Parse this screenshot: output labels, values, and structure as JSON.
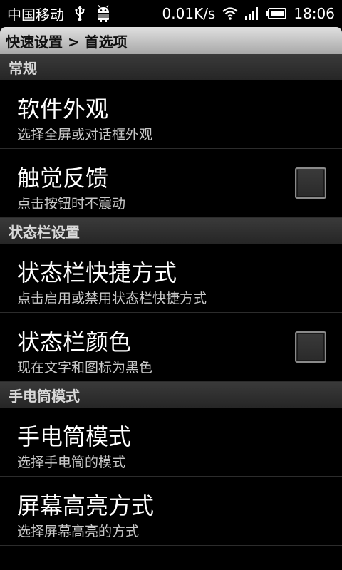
{
  "status_bar": {
    "carrier": "中国移动",
    "usb_icon": "usb-icon",
    "android_icon": "android-debug-icon",
    "speed": "0.01K/s",
    "wifi_icon": "wifi-icon",
    "signal_icon": "signal-icon",
    "battery_icon": "battery-icon",
    "time": "18:06"
  },
  "title_bar": {
    "title": "快速设置 > 首选项"
  },
  "sections": [
    {
      "header": "常规",
      "items": [
        {
          "title": "软件外观",
          "summary": "选择全屏或对话框外观",
          "checkbox": false
        },
        {
          "title": "触觉反馈",
          "summary": "点击按钮时不震动",
          "checkbox": true,
          "checked": false
        }
      ]
    },
    {
      "header": "状态栏设置",
      "items": [
        {
          "title": "状态栏快捷方式",
          "summary": "点击启用或禁用状态栏快捷方式",
          "checkbox": false
        },
        {
          "title": "状态栏颜色",
          "summary": "现在文字和图标为黑色",
          "checkbox": true,
          "checked": false
        }
      ]
    },
    {
      "header": "手电筒模式",
      "items": [
        {
          "title": "手电筒模式",
          "summary": "选择手电筒的模式",
          "checkbox": false
        },
        {
          "title": "屏幕高亮方式",
          "summary": "选择屏幕高亮的方式",
          "checkbox": false
        }
      ]
    }
  ],
  "colors": {
    "background": "#000000",
    "category_bg": "#2e2e2e",
    "title_bar_bg": "#c4c4c4",
    "summary_text": "#c8c8c8"
  }
}
